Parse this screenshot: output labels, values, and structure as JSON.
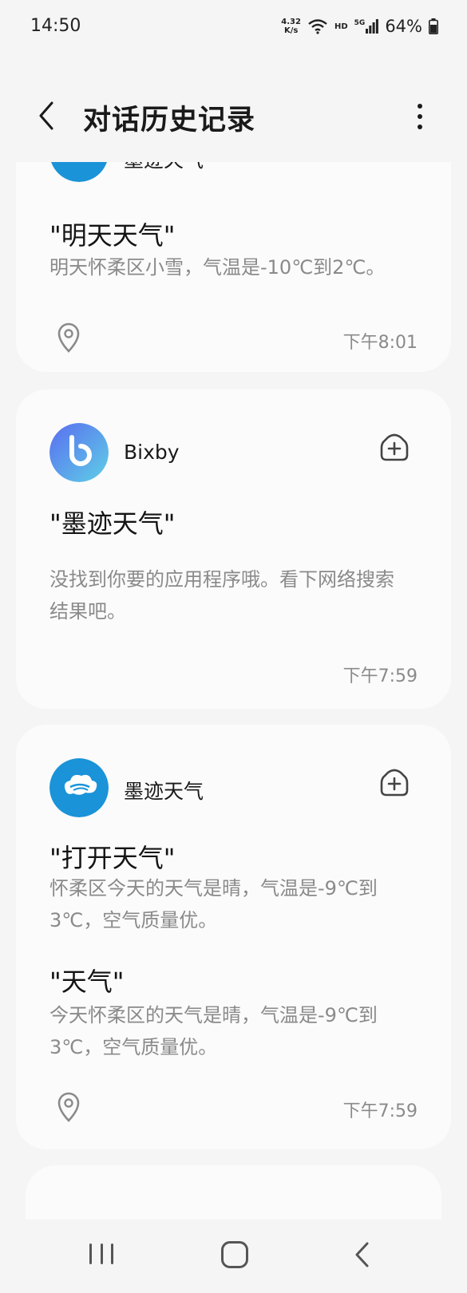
{
  "status": {
    "time": "14:50",
    "speed_line1": "4.32",
    "speed_line2": "K/s",
    "hd": "HD",
    "fiveg": "5G",
    "battery": "64%"
  },
  "header": {
    "title": "对话历史记录"
  },
  "cards": [
    {
      "app": "墨迹天气",
      "app_icon": "moji-weather-logo",
      "query": "\"明天天气\"",
      "reply": "明天怀柔区小雪，气温是-10℃到2℃。",
      "time": "下午8:01"
    },
    {
      "app": "Bixby",
      "app_icon": "bixby-logo",
      "query": "\"墨迹天气\"",
      "reply": "没找到你要的应用程序哦。看下网络搜索结果吧。",
      "time": "下午7:59"
    },
    {
      "app": "墨迹天气",
      "app_icon": "moji-weather-logo",
      "queries": [
        {
          "query": "\"打开天气\"",
          "reply": "怀柔区今天的天气是晴，气温是-9℃到3℃，空气质量优。"
        },
        {
          "query": "\"天气\"",
          "reply": "今天怀柔区的天气是晴，气温是-9℃到3℃，空气质量优。"
        }
      ],
      "time": "下午7:59"
    }
  ],
  "colors": {
    "background": "#f5f5f5",
    "card": "#fbfbfb",
    "moji_blue": "#1a93d8",
    "bixby_gradient_start": "#5a6df0",
    "bixby_gradient_end": "#5ed0e6",
    "secondary_text": "#8a8a8a"
  }
}
